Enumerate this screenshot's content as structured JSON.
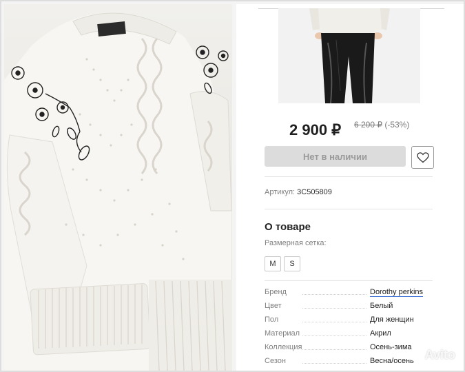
{
  "product": {
    "price": "2 900 ₽",
    "old_price": "6 200 ₽",
    "discount": "(-53%)",
    "unavailable_button": "Нет в наличии",
    "sku_label": "Артикул:",
    "sku_value": "3C505809"
  },
  "about": {
    "title": "О товаре",
    "size_chart_label": "Размерная сетка:",
    "sizes": [
      "M",
      "S"
    ]
  },
  "specs": [
    {
      "key": "Бренд",
      "value": "Dorothy perkins",
      "link": true
    },
    {
      "key": "Цвет",
      "value": "Белый"
    },
    {
      "key": "Пол",
      "value": "Для женщин"
    },
    {
      "key": "Материал",
      "value": "Акрил"
    },
    {
      "key": "Коллекция",
      "value": "Осень-зима"
    },
    {
      "key": "Сезон",
      "value": "Весна/осень"
    }
  ],
  "watermark": "Avito",
  "icons": {
    "favorite": "heart-icon",
    "watermark_logo": "avito-logo-icon"
  },
  "colors": {
    "price_text": "#1f1f1f",
    "button_disabled_bg": "#dcdcdc",
    "link_underline": "#3b6fd1"
  }
}
